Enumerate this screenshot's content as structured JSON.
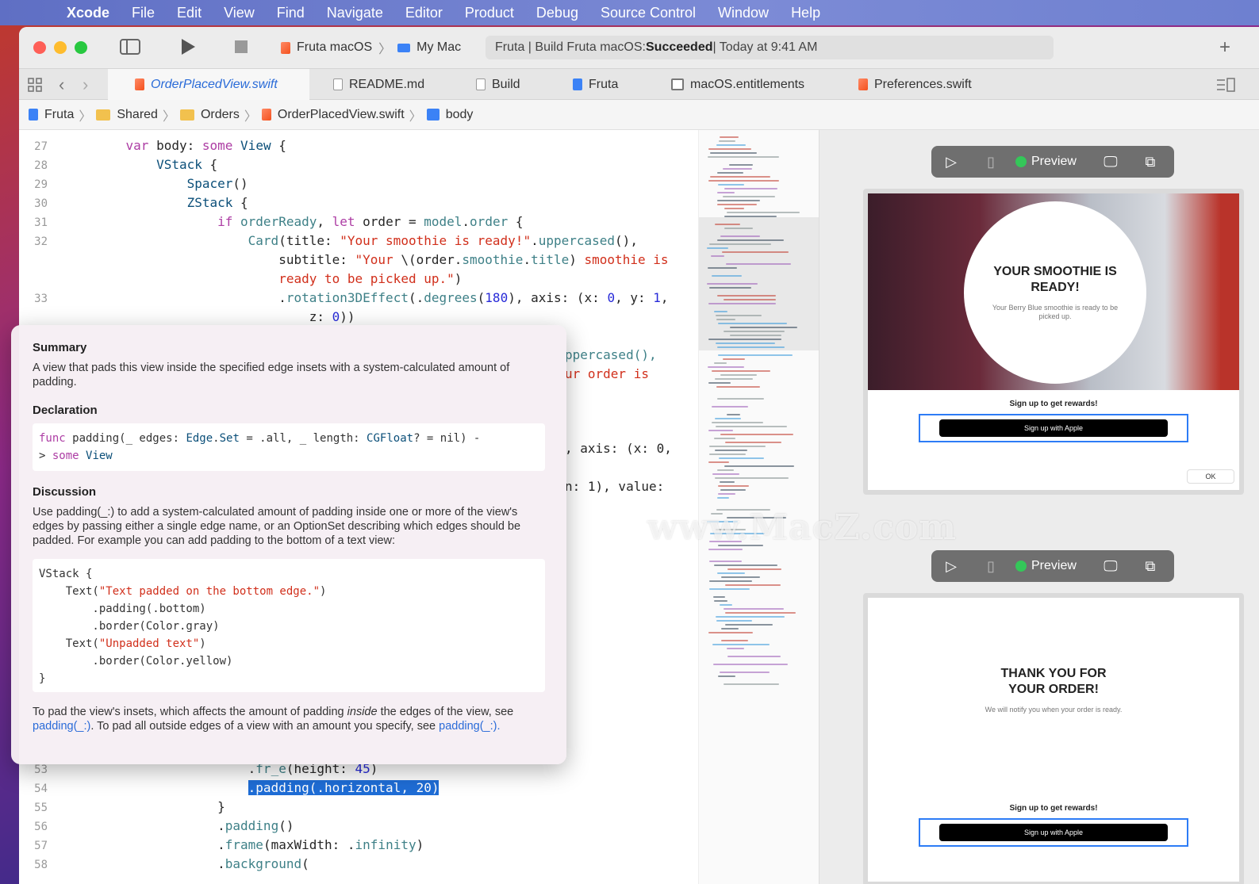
{
  "menubar": {
    "apple": "",
    "items": [
      "Xcode",
      "File",
      "Edit",
      "View",
      "Find",
      "Navigate",
      "Editor",
      "Product",
      "Debug",
      "Source Control",
      "Window",
      "Help"
    ]
  },
  "toolbar": {
    "scheme": "Fruta macOS",
    "destination": "My Mac",
    "status_prefix": "Fruta | Build Fruta macOS: ",
    "status_result": "Succeeded",
    "status_suffix": " | Today at 9:41 AM",
    "plus": "+"
  },
  "tabs": [
    "OrderPlacedView.swift",
    "README.md",
    "Build",
    "Fruta",
    "macOS.entitlements",
    "Preferences.swift"
  ],
  "breadcrumb": [
    "Fruta",
    "Shared",
    "Orders",
    "OrderPlacedView.swift",
    "body"
  ],
  "code": {
    "lines_top": [
      {
        "n": "27",
        "t": "    var body: some View {"
      },
      {
        "n": "28",
        "t": "        VStack {"
      },
      {
        "n": "29",
        "t": "            Spacer()"
      },
      {
        "n": "30",
        "t": "            ZStack {"
      },
      {
        "n": "31",
        "t": "                if orderReady, let order = model.order {"
      },
      {
        "n": "32",
        "t": "                    Card(title: \"Your smoothie is ready!\".uppercased(),"
      },
      {
        "n": "",
        "t": "                        subtitle: \"Your \\(order.smoothie.title) smoothie is"
      },
      {
        "n": "",
        "t": "                        ready to be picked up.\")"
      },
      {
        "n": "33",
        "t": "                        .rotation3DEffect(.degrees(180), axis: (x: 0, y: 1,"
      },
      {
        "n": "",
        "t": "                            z: 0))"
      }
    ],
    "peek": [
      {
        "t": "ppercased(),"
      },
      {
        "t": "ur order is"
      },
      {
        "t": ", axis: (x: 0,"
      },
      {
        "t": "n: 1), value:"
      }
    ],
    "lines_bottom": [
      {
        "n": "53",
        "t": "                    .fr_e(height: 45)"
      },
      {
        "n": "54",
        "t": "                    .padding(.horizontal, 20)"
      },
      {
        "n": "55",
        "t": "                }"
      },
      {
        "n": "56",
        "t": "                .padding()"
      },
      {
        "n": "57",
        "t": "                .frame(maxWidth: .infinity)"
      },
      {
        "n": "58",
        "t": "                .background("
      }
    ]
  },
  "quickhelp": {
    "summary_title": "Summary",
    "summary": "A view that pads this view inside the specified edge insets with a system-calculated amount of padding.",
    "declaration_title": "Declaration",
    "declaration": "func padding(_ edges: Edge.Set = .all, _ length: CGFloat? = nil) -\n> some View",
    "discussion_title": "Discussion",
    "discussion": "Use padding(_:) to add a system-calculated amount of padding inside one or more of the view's edges by passing either a single edge name, or an OptionSet describing which edges should be padded. For example you can add padding to the bottom of a text view:",
    "example": "VStack {\n    Text(\"Text padded on the bottom edge.\")\n        .padding(.bottom)\n        .border(Color.gray)\n    Text(\"Unpadded text\")\n        .border(Color.yellow)\n}",
    "footer_1": "To pad the view's insets, which affects the amount of padding ",
    "footer_em": "inside",
    "footer_2": " the edges of the view, see ",
    "footer_link1": "padding(_:)",
    "footer_3": ". To pad all outside edges of a view with an amount you specify, see ",
    "footer_link2": "padding(_:)."
  },
  "preview": {
    "label": "Preview",
    "card1": {
      "title": "YOUR SMOOTHIE IS READY!",
      "subtitle": "Your Berry Blue smoothie is ready to be picked up.",
      "signup": "Sign up to get rewards!",
      "apple_btn": "Sign up with Apple",
      "ok": "OK"
    },
    "card2": {
      "title": "THANK YOU FOR YOUR ORDER!",
      "subtitle": "We will notify you when your order is ready.",
      "signup": "Sign up to get rewards!",
      "apple_btn": "Sign up with Apple"
    }
  },
  "watermark": "www.MacZ.com",
  "colors": {
    "accent": "#2a6bd8",
    "status_green": "#34c759",
    "selection": "#1f6dd6"
  }
}
